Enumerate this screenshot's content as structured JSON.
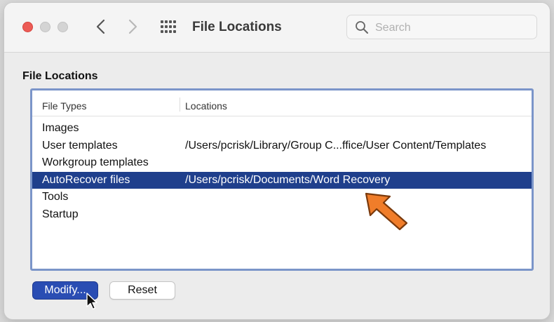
{
  "window": {
    "title": "File Locations"
  },
  "toolbar": {
    "back_icon": "chevron-left-icon",
    "forward_icon": "chevron-right-icon",
    "grid_icon": "show-all-grid-icon"
  },
  "search": {
    "placeholder": "Search",
    "value": ""
  },
  "main": {
    "section_label": "File Locations",
    "table": {
      "columns": [
        "File Types",
        "Locations"
      ],
      "rows": [
        {
          "type": "Images",
          "location": ""
        },
        {
          "type": "User templates",
          "location": "/Users/pcrisk/Library/Group C...ffice/User Content/Templates"
        },
        {
          "type": "Workgroup templates",
          "location": ""
        },
        {
          "type": "AutoRecover files",
          "location": "/Users/pcrisk/Documents/Word Recovery",
          "selected": true
        },
        {
          "type": "Tools",
          "location": ""
        },
        {
          "type": "Startup",
          "location": ""
        }
      ]
    },
    "buttons": {
      "modify": "Modify...",
      "reset": "Reset"
    }
  },
  "colors": {
    "selection": "#1f3f8c",
    "accent_button": "#2a4db3",
    "table_border": "#7b95c9",
    "close_light": "#ec5b55",
    "annotation_arrow": "#f07d2a"
  }
}
